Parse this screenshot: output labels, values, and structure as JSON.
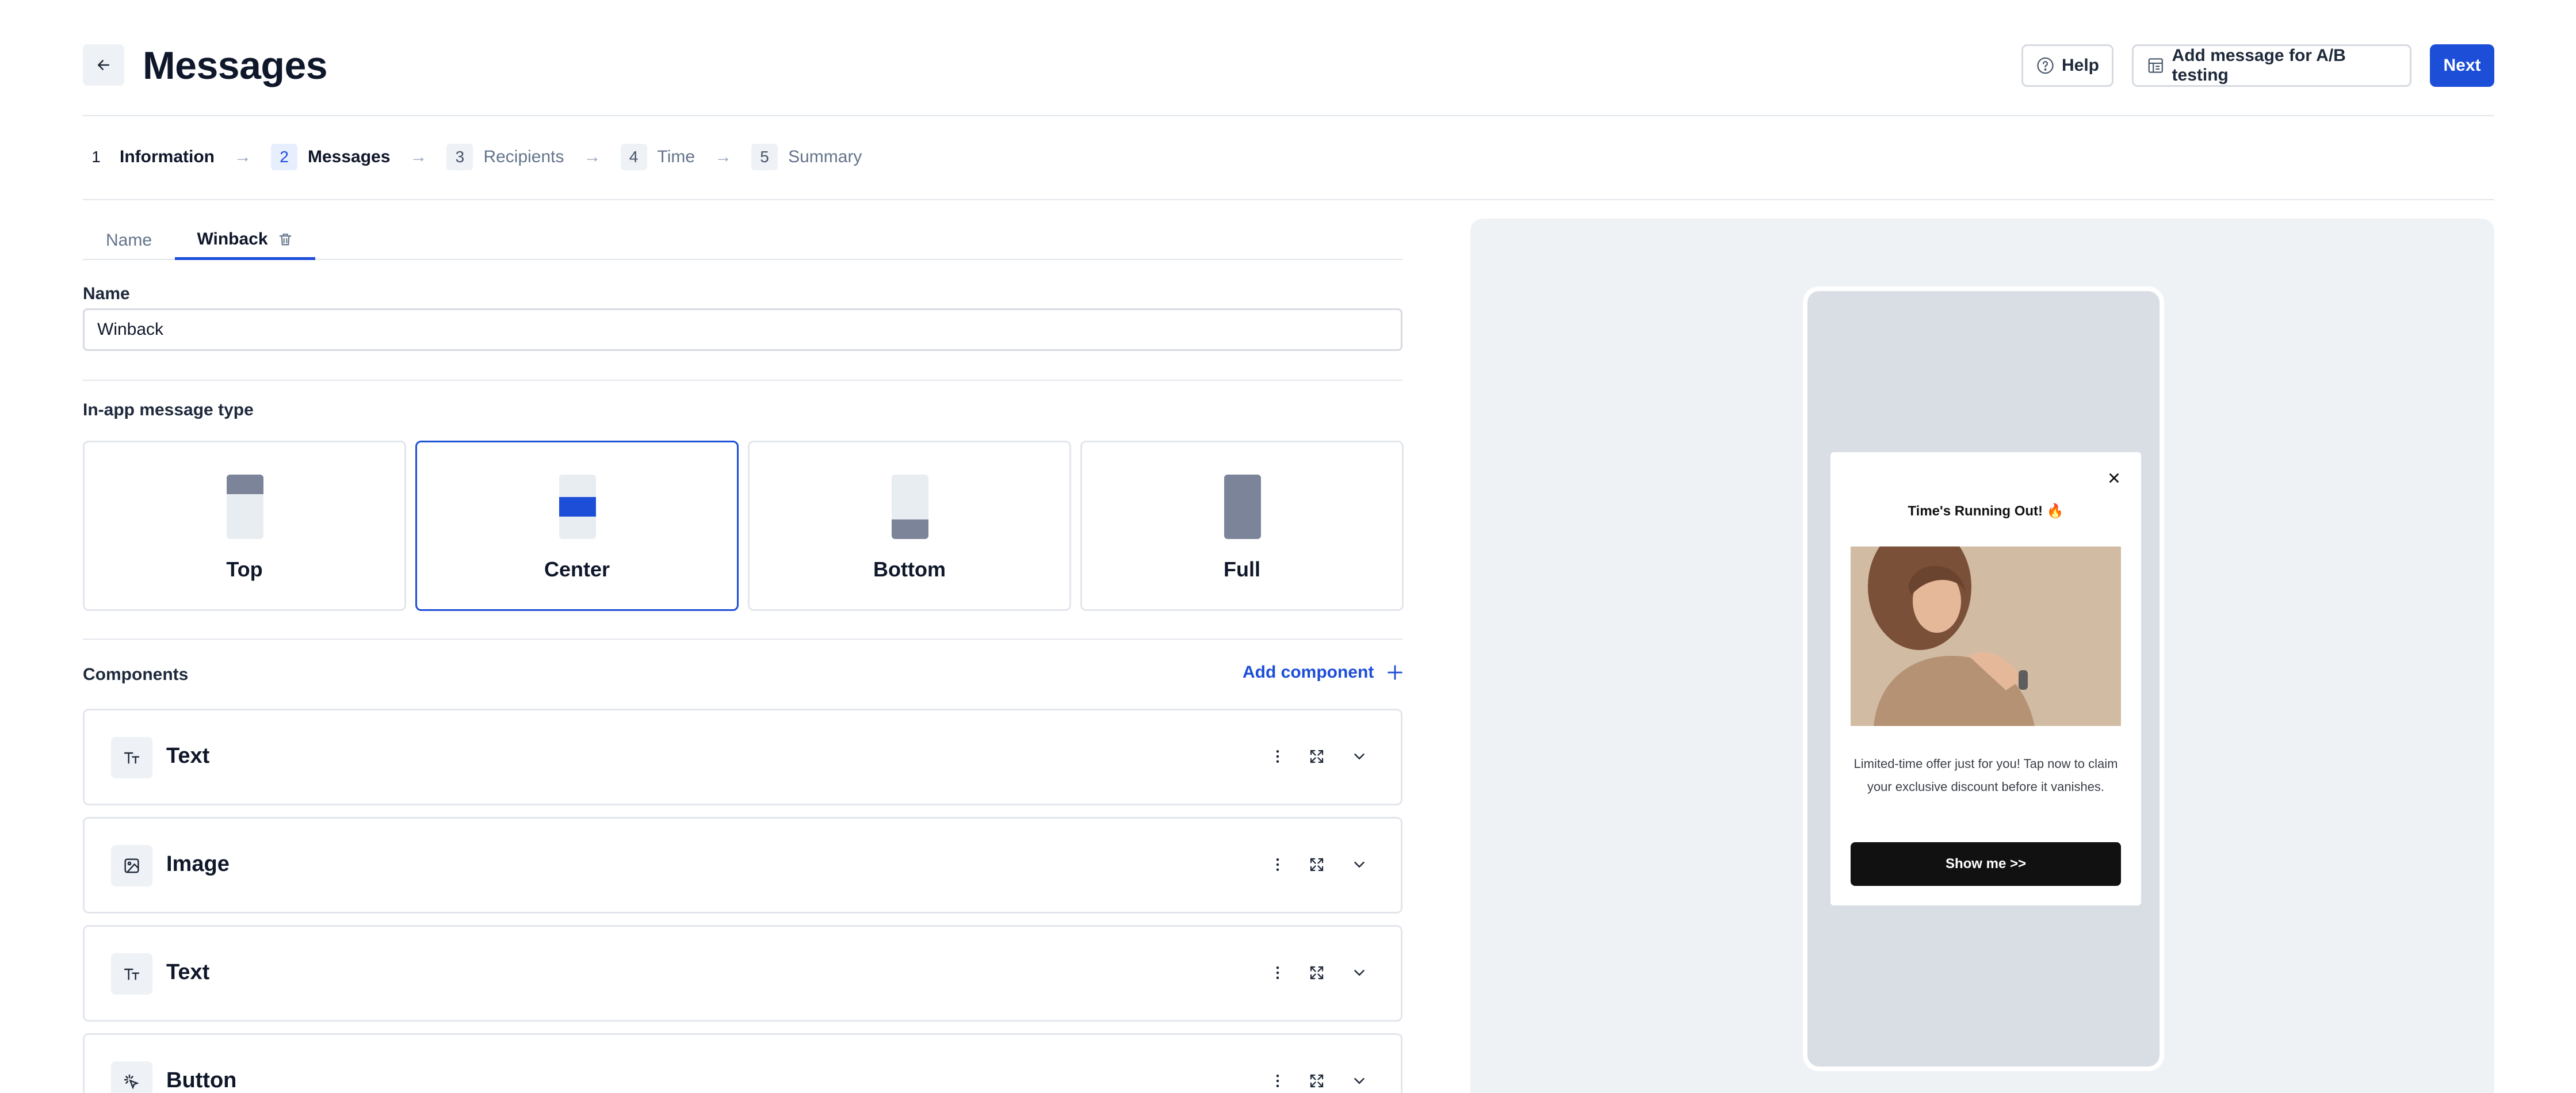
{
  "header": {
    "title": "Messages",
    "help_label": "Help",
    "ab_label": "Add message for A/B testing",
    "next_label": "Next"
  },
  "stepper": [
    {
      "num": "1",
      "label": "Information",
      "state": "done"
    },
    {
      "num": "2",
      "label": "Messages",
      "state": "current"
    },
    {
      "num": "3",
      "label": "Recipients",
      "state": "todo"
    },
    {
      "num": "4",
      "label": "Time",
      "state": "todo"
    },
    {
      "num": "5",
      "label": "Summary",
      "state": "todo"
    }
  ],
  "tabs": [
    {
      "label": "Name"
    },
    {
      "label": "Winback"
    }
  ],
  "form": {
    "name_label": "Name",
    "name_value": "Winback",
    "type_label": "In-app message type",
    "types": [
      {
        "label": "Top",
        "selected": false
      },
      {
        "label": "Center",
        "selected": true
      },
      {
        "label": "Bottom",
        "selected": false
      },
      {
        "label": "Full",
        "selected": false
      }
    ]
  },
  "components": {
    "title": "Components",
    "add_label": "Add component",
    "items": [
      {
        "name": "Text",
        "icon": "text-icon"
      },
      {
        "name": "Image",
        "icon": "image-icon"
      },
      {
        "name": "Text",
        "icon": "text-icon"
      },
      {
        "name": "Button",
        "icon": "click-icon"
      }
    ]
  },
  "preview": {
    "title": "Time's Running Out! 🔥",
    "body": "Limited-time offer just for you! Tap now to claim your exclusive discount before it vanishes.",
    "cta": "Show me >>"
  },
  "colors": {
    "accent": "#1d4ed8",
    "preview_bg": "#eff2f5",
    "device_bg": "#d9dde4",
    "cta_bg": "#111111"
  }
}
